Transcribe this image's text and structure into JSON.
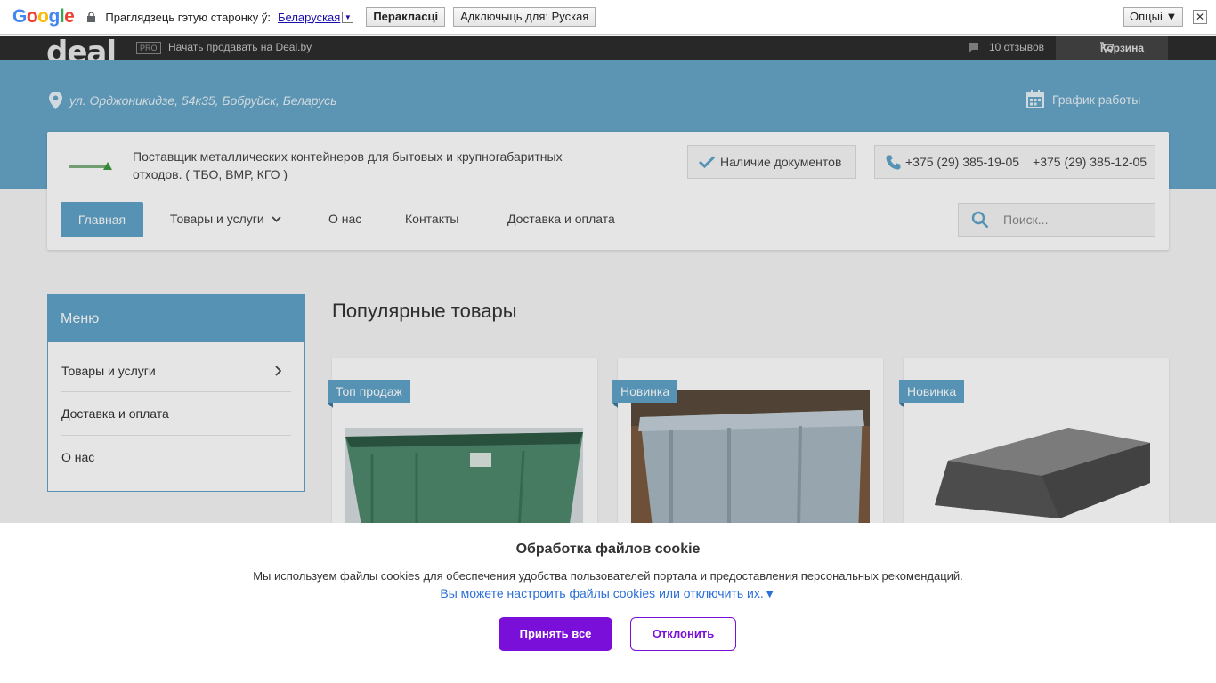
{
  "translate_bar": {
    "logo": "Google",
    "prompt": "Праглядзець гэтую старонку ў:",
    "language": "Беларуская",
    "translate_button": "Перакласці",
    "disable_button": "Адключыць для: Руская",
    "options_button": "Опцыі ▼",
    "close_glyph": "✕"
  },
  "deal_top": {
    "logo": "deal",
    "pro_badge": "PRO",
    "sell_link": "Начать продавать на Deal.by",
    "reviews_link": "10 отзывов",
    "cart_label": "Корзина"
  },
  "header": {
    "address": "ул. Орджоникидзе, 54к35, Бобруйск, Беларусь",
    "schedule": "График работы"
  },
  "company": {
    "description": "Поставщик металлических контейнеров для бытовых и крупногабаритных отходов. ( ТБО, ВМР, КГО )",
    "documents_label": "Наличие документов",
    "phone_1": "+375 (29) 385-19-05",
    "phone_2": "+375 (29) 385-12-05"
  },
  "nav": {
    "home": "Главная",
    "products": "Товары и услуги",
    "about": "О нас",
    "contacts": "Контакты",
    "delivery": "Доставка и оплата",
    "search_placeholder": "Поиск..."
  },
  "sidebar": {
    "title": "Меню",
    "items": [
      {
        "label": "Товары и услуги"
      },
      {
        "label": "Доставка и оплата"
      },
      {
        "label": "О нас"
      }
    ]
  },
  "popular": {
    "title": "Популярные товары",
    "products": [
      {
        "badge": "Топ продаж",
        "image_color": "#4e8a6c"
      },
      {
        "badge": "Новинка",
        "image_color": "#a9b8c2"
      },
      {
        "badge": "Новинка",
        "image_color": "#6d6d6d"
      }
    ]
  },
  "cookie": {
    "title": "Обработка файлов cookie",
    "text": "Мы используем файлы cookies для обеспечения удобства пользователей портала и предоставления персональных рекомендаций.",
    "link": "Вы можете настроить файлы cookies или отключить их.▼",
    "accept": "Принять все",
    "decline": "Отклонить"
  },
  "colors": {
    "accent_blue": "#5fa3c9",
    "cookie_purple": "#7a0fd9"
  }
}
